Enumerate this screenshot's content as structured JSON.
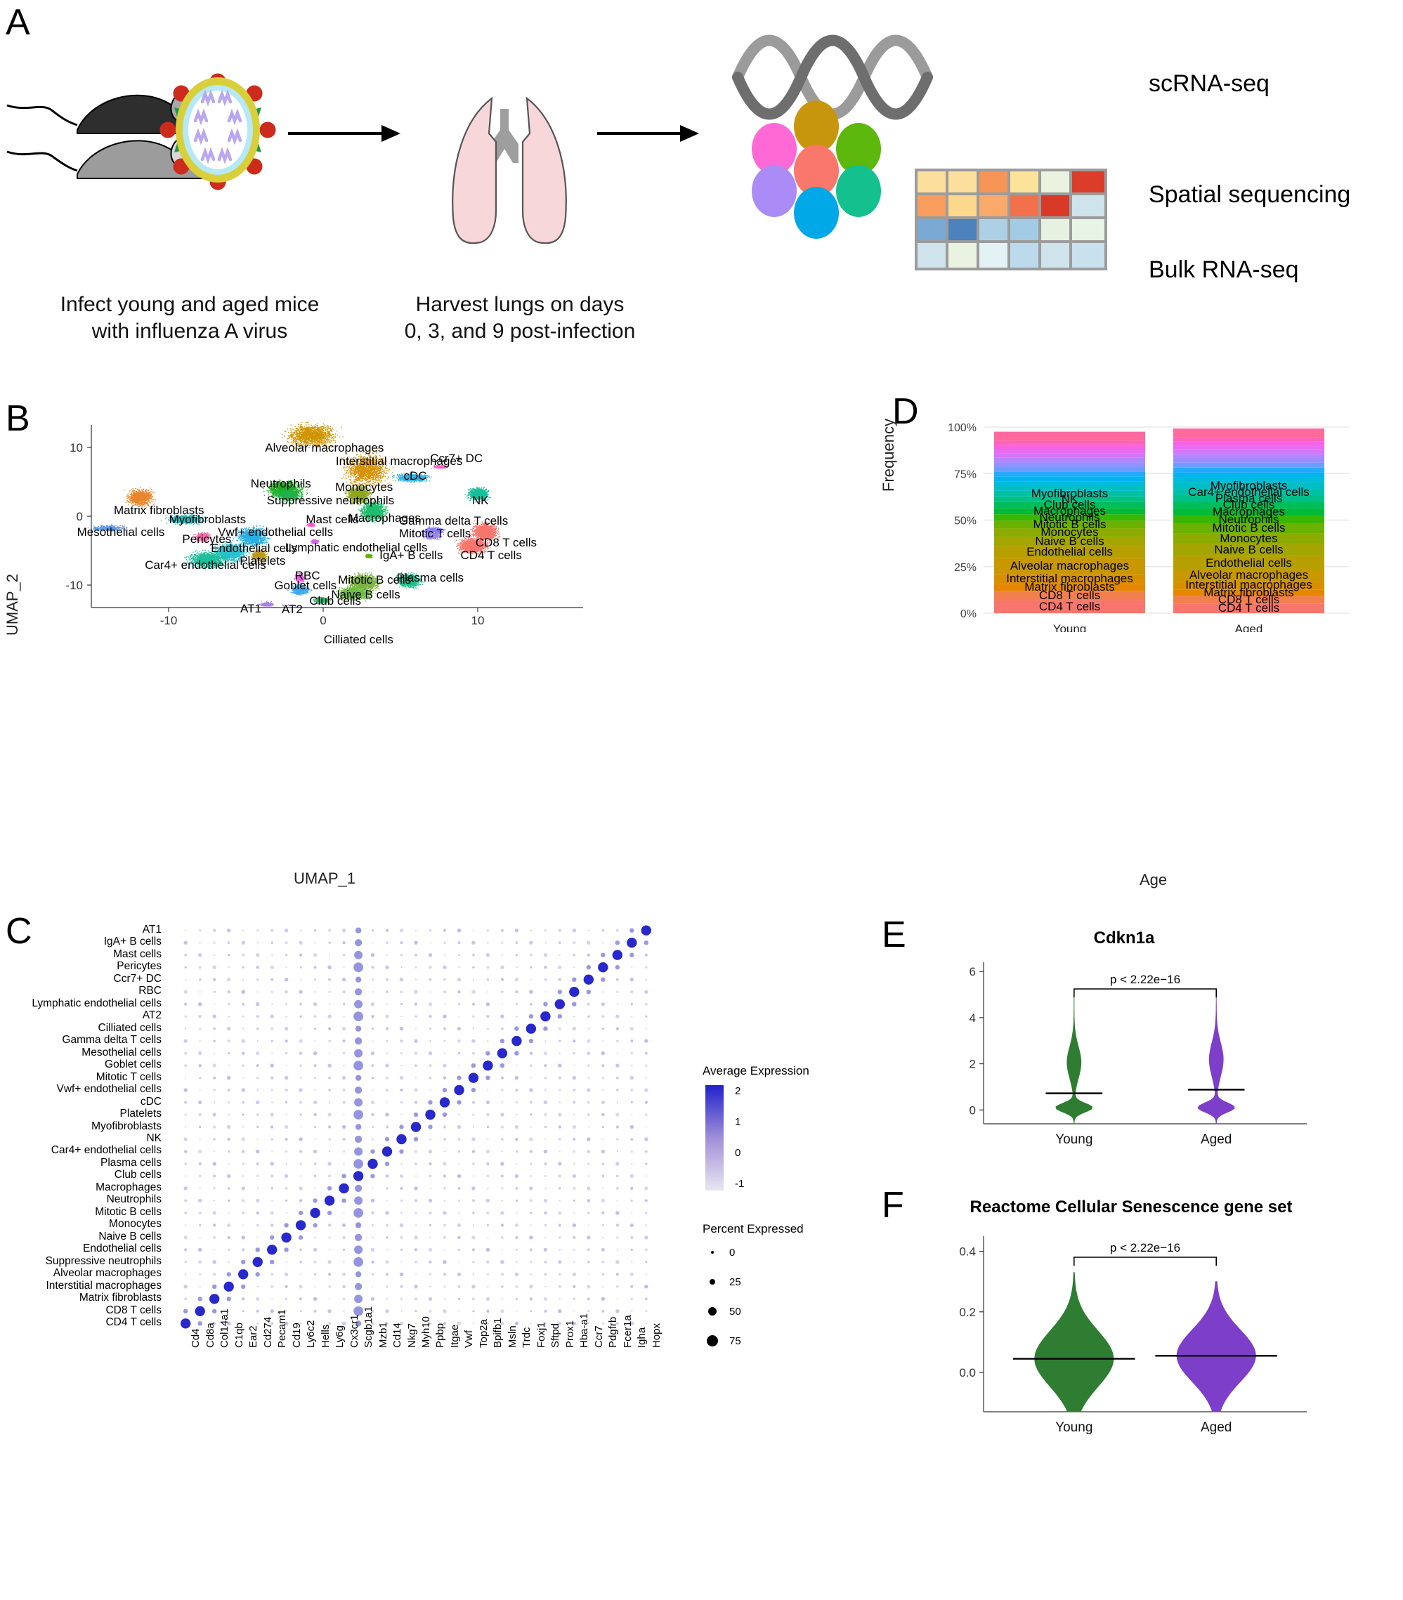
{
  "panels": {
    "a": "A",
    "b": "B",
    "c": "C",
    "d": "D",
    "e": "E",
    "f": "F"
  },
  "panel_a": {
    "caption1_line1": "Infect young and aged mice",
    "caption1_line2": "with influenza A virus",
    "caption2_line1": "Harvest lungs on days",
    "caption2_line2": "0, 3, and 9 post-infection",
    "assay1": "scRNA-seq",
    "assay2": "Spatial sequencing",
    "assay3": "Bulk RNA-seq",
    "spatial_colors": [
      "#ff69d6",
      "#c8960c",
      "#5cb80c",
      "#f9776b",
      "#14c08e",
      "#00a8e8",
      "#ab8bf5"
    ],
    "heatmap_colors": [
      [
        "#fcdf9c",
        "#fcdf9c",
        "#f79557",
        "#fce39a",
        "#e9f3e0",
        "#dc3c2a"
      ],
      [
        "#f99d5e",
        "#fcd88c",
        "#f9a96a",
        "#f2704a",
        "#d93a28",
        "#cfe3ec"
      ],
      [
        "#7aa9d4",
        "#4d82bd",
        "#aed0e4",
        "#a3cbe3",
        "#e6f1e2",
        "#e8f4e6"
      ],
      [
        "#cfe3ec",
        "#e9f3e0",
        "#e3f3f5",
        "#bdd9ec",
        "#cfe3ec",
        "#c9e0ef"
      ]
    ],
    "mouse_dark": "#2e2e2e",
    "mouse_light": "#9c9c9c",
    "lung_fill": "#f7d7d9",
    "virus_ring": "#d8cf3a",
    "virus_inner": "#b6e8f5"
  },
  "chart_data": [
    {
      "id": "umap",
      "type": "scatter",
      "title": "",
      "xlabel": "UMAP_1",
      "ylabel": "UMAP_2",
      "xticks": [
        -10,
        0,
        10
      ],
      "yticks": [
        -10,
        0,
        10
      ],
      "xlim": [
        -17,
        13
      ],
      "ylim": [
        -17,
        15
      ],
      "grid": false,
      "clusters": [
        {
          "label": "Alveolar macrophages",
          "color": "#cf9400",
          "lx": 389,
          "ly": 467,
          "cx": 470,
          "cy": 447,
          "rx": 62,
          "ry": 30,
          "n": 2200
        },
        {
          "label": "Interstitial macrophages",
          "color": "#d69000",
          "lx": 512,
          "ly": 492,
          "cx": 565,
          "cy": 510,
          "rx": 62,
          "ry": 42,
          "n": 2400
        },
        {
          "label": "Ccr7+ DC",
          "color": "#ff61c3",
          "lx": 676,
          "ly": 487,
          "cx": 694,
          "cy": 504,
          "rx": 20,
          "ry": 5,
          "n": 200
        },
        {
          "label": "cDC",
          "color": "#2cb5e8",
          "lx": 630,
          "ly": 518,
          "cx": 646,
          "cy": 524,
          "rx": 42,
          "ry": 11,
          "n": 900
        },
        {
          "label": "Neutrophils",
          "color": "#1cb11c",
          "lx": 364,
          "ly": 533,
          "cx": 424,
          "cy": 545,
          "rx": 44,
          "ry": 22,
          "n": 1700
        },
        {
          "label": "Monocytes",
          "color": "#8ea61a",
          "lx": 511,
          "ly": 539,
          "cx": 552,
          "cy": 555,
          "rx": 30,
          "ry": 22,
          "n": 1200
        },
        {
          "label": "Suppressive neutrophils",
          "color": "#22b14c",
          "lx": 392,
          "ly": 564,
          "cx": 430,
          "cy": 556,
          "rx": 36,
          "ry": 15,
          "n": 700
        },
        {
          "label": "NK",
          "color": "#16bf9a",
          "lx": 749,
          "ly": 563,
          "cx": 760,
          "cy": 554,
          "rx": 28,
          "ry": 17,
          "n": 900
        },
        {
          "label": "Macrophages",
          "color": "#1fbe6e",
          "lx": 534,
          "ly": 595,
          "cx": 578,
          "cy": 585,
          "rx": 33,
          "ry": 25,
          "n": 1500
        },
        {
          "label": "Mast cells",
          "color": "#ff4fd8",
          "lx": 460,
          "ly": 598,
          "cx": 469,
          "cy": 610,
          "rx": 10,
          "ry": 5,
          "n": 120
        },
        {
          "label": "Matrix fibroblasts",
          "color": "#e8852b",
          "lx": 126,
          "ly": 581,
          "cx": 172,
          "cy": 560,
          "rx": 35,
          "ry": 23,
          "n": 1000
        },
        {
          "label": "Myofibroblasts",
          "color": "#25b7b7",
          "lx": 222,
          "ly": 598,
          "cx": 250,
          "cy": 600,
          "rx": 45,
          "ry": 12,
          "n": 900
        },
        {
          "label": "Mesothelial cells",
          "color": "#5f9be8",
          "lx": 62,
          "ly": 621,
          "cx": 117,
          "cy": 616,
          "rx": 42,
          "ry": 8,
          "n": 400
        },
        {
          "label": "Gamma delta T cells",
          "color": "#8b7ff0",
          "lx": 622,
          "ly": 600,
          "cx": 682,
          "cy": 621,
          "rx": 28,
          "ry": 10,
          "n": 450
        },
        {
          "label": "Mitotic T cells",
          "color": "#9a86f2",
          "lx": 622,
          "ly": 624,
          "cx": 680,
          "cy": 631,
          "rx": 24,
          "ry": 8,
          "n": 300
        },
        {
          "label": "Vwf+ endothelial cells",
          "color": "#2aaee0",
          "lx": 307,
          "ly": 621,
          "cx": 368,
          "cy": 632,
          "rx": 40,
          "ry": 25,
          "n": 1300
        },
        {
          "label": "Pericytes",
          "color": "#f06ba8",
          "lx": 245,
          "ly": 634,
          "cx": 281,
          "cy": 632,
          "rx": 20,
          "ry": 12,
          "n": 400
        },
        {
          "label": "Endothelial cells",
          "color": "#2cc0d0",
          "lx": 295,
          "ly": 651,
          "cx": 330,
          "cy": 660,
          "rx": 42,
          "ry": 24,
          "n": 1600
        },
        {
          "label": "Lymphatic endothelial cells",
          "color": "#d663e8",
          "lx": 424,
          "ly": 649,
          "cx": 476,
          "cy": 641,
          "rx": 10,
          "ry": 6,
          "n": 200
        },
        {
          "label": "CD8 T cells",
          "color": "#f8766d",
          "lx": 755,
          "ly": 640,
          "cx": 772,
          "cy": 623,
          "rx": 34,
          "ry": 23,
          "n": 2100
        },
        {
          "label": "CD4 T cells",
          "color": "#f8766d",
          "lx": 729,
          "ly": 663,
          "cx": 750,
          "cy": 648,
          "rx": 38,
          "ry": 20,
          "n": 2000
        },
        {
          "label": "Platelets",
          "color": "#b89a1e",
          "lx": 345,
          "ly": 674,
          "cx": 379,
          "cy": 666,
          "rx": 22,
          "ry": 15,
          "n": 500
        },
        {
          "label": "IgA+ B cells",
          "color": "#5cb300",
          "lx": 588,
          "ly": 663,
          "cx": 570,
          "cy": 667,
          "rx": 8,
          "ry": 5,
          "n": 150
        },
        {
          "label": "Car4+ endothelial cells",
          "color": "#1bbf9c",
          "lx": 180,
          "ly": 682,
          "cx": 289,
          "cy": 674,
          "rx": 50,
          "ry": 22,
          "n": 1400
        },
        {
          "label": "Mitotic B cells",
          "color": "#7cb342",
          "lx": 516,
          "ly": 708,
          "cx": 560,
          "cy": 715,
          "rx": 40,
          "ry": 22,
          "n": 1600
        },
        {
          "label": "Plasma cells",
          "color": "#1fbe8a",
          "lx": 618,
          "ly": 705,
          "cx": 640,
          "cy": 712,
          "rx": 30,
          "ry": 18,
          "n": 1100
        },
        {
          "label": "RBC",
          "color": "#e964e0",
          "lx": 441,
          "ly": 700,
          "cx": 450,
          "cy": 707,
          "rx": 14,
          "ry": 12,
          "n": 350
        },
        {
          "label": "Goblet cells",
          "color": "#3ea8ef",
          "lx": 405,
          "ly": 719,
          "cx": 450,
          "cy": 729,
          "rx": 24,
          "ry": 13,
          "n": 500
        },
        {
          "label": "Naive B cells",
          "color": "#6fbe3e",
          "lx": 504,
          "ly": 735,
          "cx": 545,
          "cy": 735,
          "rx": 40,
          "ry": 16,
          "n": 1500
        },
        {
          "label": "Club cells",
          "color": "#24b56e",
          "lx": 466,
          "ly": 747,
          "cx": 488,
          "cy": 748,
          "rx": 20,
          "ry": 9,
          "n": 400
        },
        {
          "label": "AT1",
          "color": "#a97ee8",
          "lx": 346,
          "ly": 761,
          "cx": 392,
          "cy": 757,
          "rx": 18,
          "ry": 10,
          "n": 350
        },
        {
          "label": "AT2",
          "color": "#b98ef0",
          "lx": 418,
          "ly": 762,
          "cx": 432,
          "cy": 766,
          "rx": 36,
          "ry": 14,
          "n": 1000
        },
        {
          "label": "Cilliated cells",
          "color": "#c08ff5",
          "lx": 491,
          "ly": 817,
          "cx": 510,
          "cy": 795,
          "rx": 8,
          "ry": 18,
          "n": 300
        }
      ]
    },
    {
      "id": "stacked_frequency",
      "type": "bar",
      "stacked": true,
      "title": "",
      "xlabel": "Age",
      "ylabel": "Frequency",
      "categories": [
        "Young",
        "Aged"
      ],
      "yticks": [
        "0%",
        "25%",
        "50%",
        "75%",
        "100%"
      ],
      "ylim": [
        0,
        100
      ],
      "young_labels": [
        "CD4 T cells",
        "CD8 T cells",
        "Matrix fibroblasts",
        "Interstitial macrophages",
        "Alveolar macrophages",
        "Endothelial cells",
        "Naive B cells",
        "Monocytes",
        "Mitotic B cells",
        "Neutrophils",
        "Macrophages",
        "Club cells",
        "NK",
        "Myofibroblasts"
      ],
      "aged_labels": [
        "CD4 T cells",
        "CD8 T cells",
        "Matrix fibroblasts",
        "Interstitial macrophages",
        "Alveolar macrophages",
        "Endothelial cells",
        "Naive B cells",
        "Monocytes",
        "Mitotic B cells",
        "Neutrophils",
        "Macrophages",
        "Club cells",
        "Plasma cells",
        "Car4+ endothelial cells",
        "Myofibroblasts"
      ],
      "young_segments": [
        {
          "label": "CD4 T cells",
          "pct": 7.0,
          "color": "#f8766d"
        },
        {
          "label": "CD8 T cells",
          "pct": 5.0,
          "color": "#f2804f"
        },
        {
          "label": "Matrix fibroblasts",
          "pct": 3.8,
          "color": "#e58700"
        },
        {
          "label": "Interstitial macrophages",
          "pct": 5.2,
          "color": "#d89000"
        },
        {
          "label": "Alveolar macrophages",
          "pct": 8.5,
          "color": "#c99800"
        },
        {
          "label": "Endothelial cells",
          "pct": 6.5,
          "color": "#b79f00"
        },
        {
          "label": "Naive B cells",
          "pct": 5.0,
          "color": "#a3a500"
        },
        {
          "label": "Monocytes",
          "pct": 4.5,
          "color": "#8cab00"
        },
        {
          "label": "Mitotic B cells",
          "pct": 4.2,
          "color": "#6bb100"
        },
        {
          "label": "Neutrophils",
          "pct": 3.4,
          "color": "#39b600"
        },
        {
          "label": "Macrophages",
          "pct": 3.4,
          "color": "#00ba38"
        },
        {
          "label": "Club cells",
          "pct": 3.2,
          "color": "#00bd5c"
        },
        {
          "label": "NK",
          "pct": 3.0,
          "color": "#00c087"
        },
        {
          "label": "Myofibroblasts",
          "pct": 3.0,
          "color": "#00c1a3"
        },
        {
          "label": "",
          "pct": 2.6,
          "color": "#00bfc4"
        },
        {
          "label": "",
          "pct": 2.6,
          "color": "#00bbdb"
        },
        {
          "label": "",
          "pct": 2.6,
          "color": "#00b4ef"
        },
        {
          "label": "",
          "pct": 2.6,
          "color": "#24a9ff"
        },
        {
          "label": "",
          "pct": 2.6,
          "color": "#6f9cff"
        },
        {
          "label": "",
          "pct": 2.4,
          "color": "#9590ff"
        },
        {
          "label": "",
          "pct": 2.4,
          "color": "#b983ff"
        },
        {
          "label": "",
          "pct": 2.4,
          "color": "#d376f8"
        },
        {
          "label": "",
          "pct": 2.4,
          "color": "#e76bf3"
        },
        {
          "label": "",
          "pct": 2.2,
          "color": "#f564e3"
        },
        {
          "label": "",
          "pct": 2.2,
          "color": "#ff62bc"
        },
        {
          "label": "",
          "pct": 2.2,
          "color": "#ff6a98"
        },
        {
          "label": "",
          "pct": 2.6,
          "color": "#ff68a1"
        }
      ],
      "aged_segments": [
        {
          "label": "CD4 T cells",
          "pct": 5.0,
          "color": "#f8766d"
        },
        {
          "label": "CD8 T cells",
          "pct": 4.2,
          "color": "#f2804f"
        },
        {
          "label": "Matrix fibroblasts",
          "pct": 3.5,
          "color": "#e58700"
        },
        {
          "label": "Interstitial macrophages",
          "pct": 4.5,
          "color": "#d89000"
        },
        {
          "label": "Alveolar macrophages",
          "pct": 6.0,
          "color": "#c99800"
        },
        {
          "label": "Endothelial cells",
          "pct": 7.5,
          "color": "#b79f00"
        },
        {
          "label": "Naive B cells",
          "pct": 6.5,
          "color": "#a3a500"
        },
        {
          "label": "Monocytes",
          "pct": 5.8,
          "color": "#8cab00"
        },
        {
          "label": "Mitotic B cells",
          "pct": 5.0,
          "color": "#6bb100"
        },
        {
          "label": "Neutrophils",
          "pct": 4.2,
          "color": "#39b600"
        },
        {
          "label": "Macrophages",
          "pct": 4.0,
          "color": "#00ba38"
        },
        {
          "label": "Club cells",
          "pct": 3.6,
          "color": "#00bd5c"
        },
        {
          "label": "Plasma cells",
          "pct": 3.4,
          "color": "#00c087"
        },
        {
          "label": "Car4+ endothelial cells",
          "pct": 3.2,
          "color": "#00c1a3"
        },
        {
          "label": "Myofibroblasts",
          "pct": 4.0,
          "color": "#00bfc4"
        },
        {
          "label": "",
          "pct": 2.6,
          "color": "#00bbdb"
        },
        {
          "label": "",
          "pct": 2.6,
          "color": "#00b4ef"
        },
        {
          "label": "",
          "pct": 2.6,
          "color": "#24a9ff"
        },
        {
          "label": "",
          "pct": 2.6,
          "color": "#6f9cff"
        },
        {
          "label": "",
          "pct": 2.4,
          "color": "#9590ff"
        },
        {
          "label": "",
          "pct": 2.4,
          "color": "#b983ff"
        },
        {
          "label": "",
          "pct": 2.4,
          "color": "#d376f8"
        },
        {
          "label": "",
          "pct": 2.2,
          "color": "#e76bf3"
        },
        {
          "label": "",
          "pct": 2.2,
          "color": "#f564e3"
        },
        {
          "label": "",
          "pct": 2.2,
          "color": "#ff62bc"
        },
        {
          "label": "",
          "pct": 2.2,
          "color": "#ff6a98"
        },
        {
          "label": "",
          "pct": 2.4,
          "color": "#ff68a1"
        }
      ]
    },
    {
      "id": "dotplot",
      "type": "heatmap",
      "title": "",
      "xlabel": "",
      "ylabel": "",
      "legend_color_title": "Average Expression",
      "legend_color_ticks": [
        "2",
        "1",
        "0",
        "-1"
      ],
      "legend_size_title": "Percent Expressed",
      "legend_size_ticks": [
        "0",
        "25",
        "50",
        "75"
      ],
      "genes": [
        "Cd4",
        "Cd8a",
        "Col14a1",
        "C1qb",
        "Ear2",
        "Cd274",
        "Pecam1",
        "Cd19",
        "Ly6c2",
        "Hells",
        "Ly6g",
        "Cx3cr1",
        "Scgb1a1",
        "Mzb1",
        "Cd14",
        "Nkg7",
        "Myh10",
        "Ppbp",
        "Itgae",
        "Vwf",
        "Top2a",
        "Bpifb1",
        "Msln",
        "Trdc",
        "Foxj1",
        "Sftpd",
        "Prox1",
        "Hba-a1",
        "Ccr7",
        "Pdgfrb",
        "Fcer1a",
        "Igha",
        "Hopx"
      ],
      "celltypes": [
        "AT1",
        "IgA+ B cells",
        "Mast cells",
        "Pericytes",
        "Ccr7+ DC",
        "RBC",
        "Lymphatic endothelial cells",
        "AT2",
        "Cilliated cells",
        "Gamma delta T cells",
        "Mesothelial cells",
        "Goblet cells",
        "Mitotic T cells",
        "Vwf+ endothelial cells",
        "cDC",
        "Platelets",
        "Myofibroblasts",
        "NK",
        "Car4+ endothelial cells",
        "Plasma cells",
        "Club cells",
        "Macrophages",
        "Neutrophils",
        "Mitotic B cells",
        "Monocytes",
        "Naive B cells",
        "Endothelial cells",
        "Suppressive neutrophils",
        "Alveolar macrophages",
        "Interstitial macrophages",
        "Matrix fibroblasts",
        "CD8 T cells",
        "CD4 T cells"
      ],
      "diagonal_marker_index": [
        32,
        31,
        30,
        29,
        28,
        27,
        26,
        25,
        24,
        23,
        22,
        21,
        20,
        19,
        18,
        17,
        16,
        15,
        14,
        13,
        12,
        11,
        10,
        9,
        8,
        7,
        6,
        5,
        4,
        3,
        2,
        1,
        0
      ]
    },
    {
      "id": "violin_cdkn1a",
      "type": "violin",
      "title": "Cdkn1a",
      "xlabel": "",
      "ylabel": "",
      "categories": [
        "Young",
        "Aged"
      ],
      "yticks": [
        0,
        2,
        4,
        6
      ],
      "ylim": [
        -0.6,
        6.4
      ],
      "pvalue": "p < 2.22e−16",
      "series": [
        {
          "name": "Young",
          "color": "#2f7d32",
          "median": 0.72,
          "max": 4.9
        },
        {
          "name": "Aged",
          "color": "#7d3ec9",
          "median": 0.88,
          "max": 5.2
        }
      ]
    },
    {
      "id": "violin_senescence",
      "type": "violin",
      "title": "Reactome Cellular Senescence gene set",
      "xlabel": "",
      "ylabel": "",
      "categories": [
        "Young",
        "Aged"
      ],
      "yticks": [
        0.0,
        0.2,
        0.4
      ],
      "ylim": [
        -0.13,
        0.45
      ],
      "pvalue": "p < 2.22e−16",
      "series": [
        {
          "name": "Young",
          "color": "#2f7d32",
          "median": 0.045,
          "max": 0.33
        },
        {
          "name": "Aged",
          "color": "#7d3ec9",
          "median": 0.055,
          "max": 0.3
        }
      ]
    }
  ]
}
